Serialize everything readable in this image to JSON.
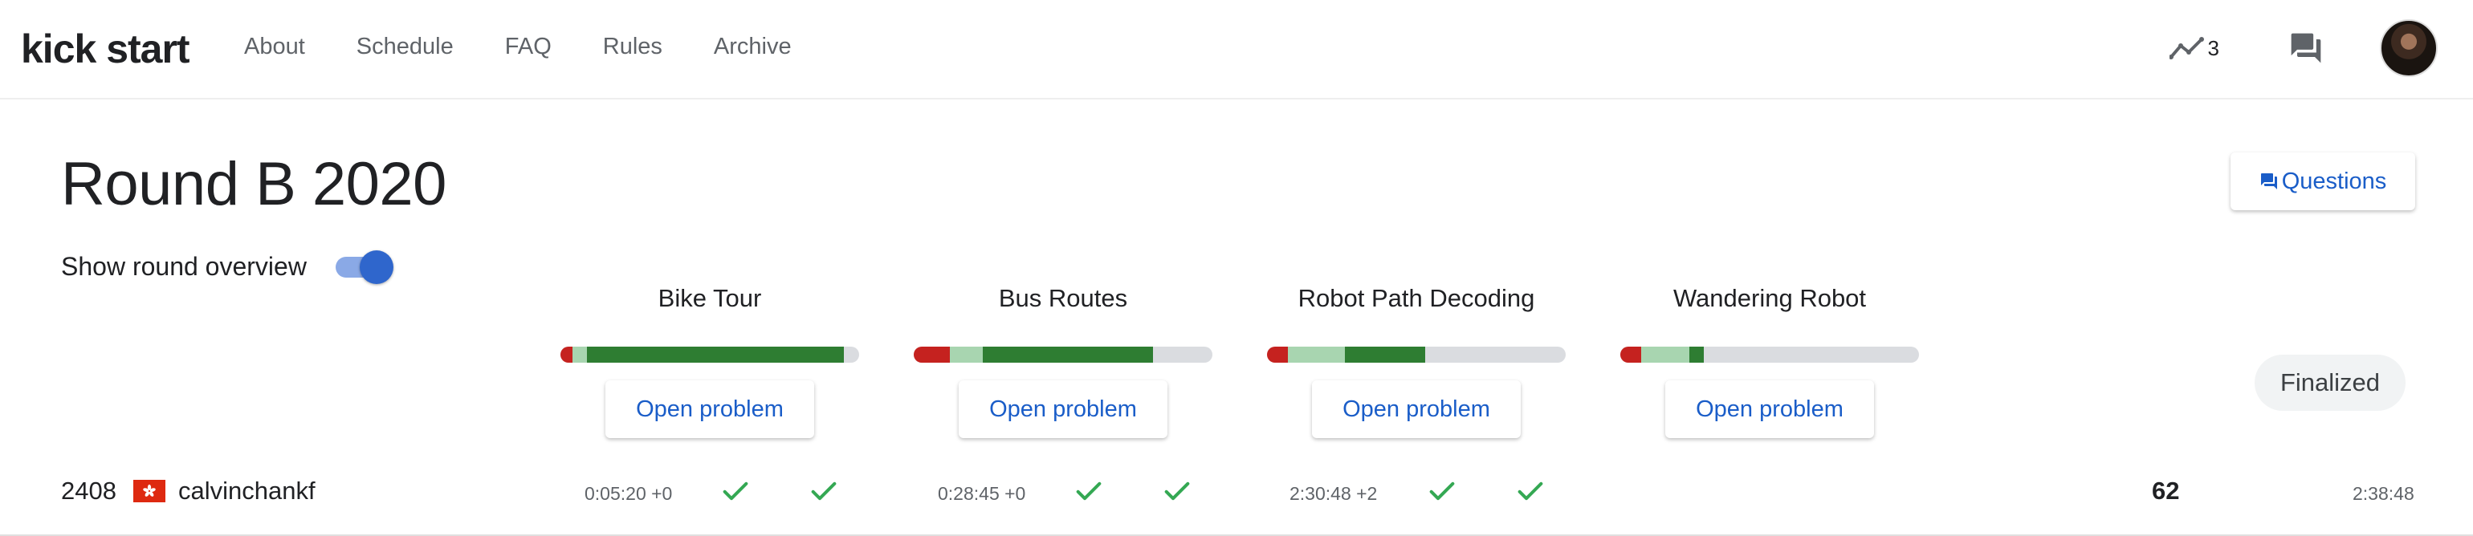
{
  "header": {
    "logo": "kick start",
    "nav": [
      "About",
      "Schedule",
      "FAQ",
      "Rules",
      "Archive"
    ],
    "trend_count": "3",
    "icons": [
      "trending-up-icon",
      "forum-icon",
      "avatar"
    ]
  },
  "round": {
    "title": "Round B 2020",
    "overview_label": "Show round overview",
    "overview_toggle_on": true,
    "questions_label": "Questions"
  },
  "problems": [
    {
      "name": "Bike Tour",
      "open_label": "Open problem",
      "attempt_fractions": {
        "incorrect": 0.04,
        "small_only": 0.05,
        "full": 0.86
      }
    },
    {
      "name": "Bus Routes",
      "open_label": "Open problem",
      "attempt_fractions": {
        "incorrect": 0.12,
        "small_only": 0.11,
        "full": 0.57
      }
    },
    {
      "name": "Robot Path Decoding",
      "open_label": "Open problem",
      "attempt_fractions": {
        "incorrect": 0.07,
        "small_only": 0.19,
        "full": 0.27
      }
    },
    {
      "name": "Wandering Robot",
      "open_label": "Open problem",
      "attempt_fractions": {
        "incorrect": 0.07,
        "small_only": 0.16,
        "full": 0.05
      }
    }
  ],
  "status_label": "Finalized",
  "scoreboard": {
    "row": {
      "rank": "2408",
      "username": "calvinchankf",
      "results": [
        {
          "time": "0:05:20 +0",
          "checks": 2
        },
        {
          "time": "0:28:45 +0",
          "checks": 2
        },
        {
          "time": "2:30:48 +2",
          "checks": 2
        },
        {
          "time": "",
          "checks": 0
        }
      ],
      "score": "62",
      "total_time": "2:38:48"
    }
  },
  "colors": {
    "accent_blue": "#1a5dc8",
    "bar_incorrect": "#c5221f",
    "bar_small": "#a8d5b0",
    "bar_full": "#2e7d32",
    "check_green": "#34a853"
  }
}
